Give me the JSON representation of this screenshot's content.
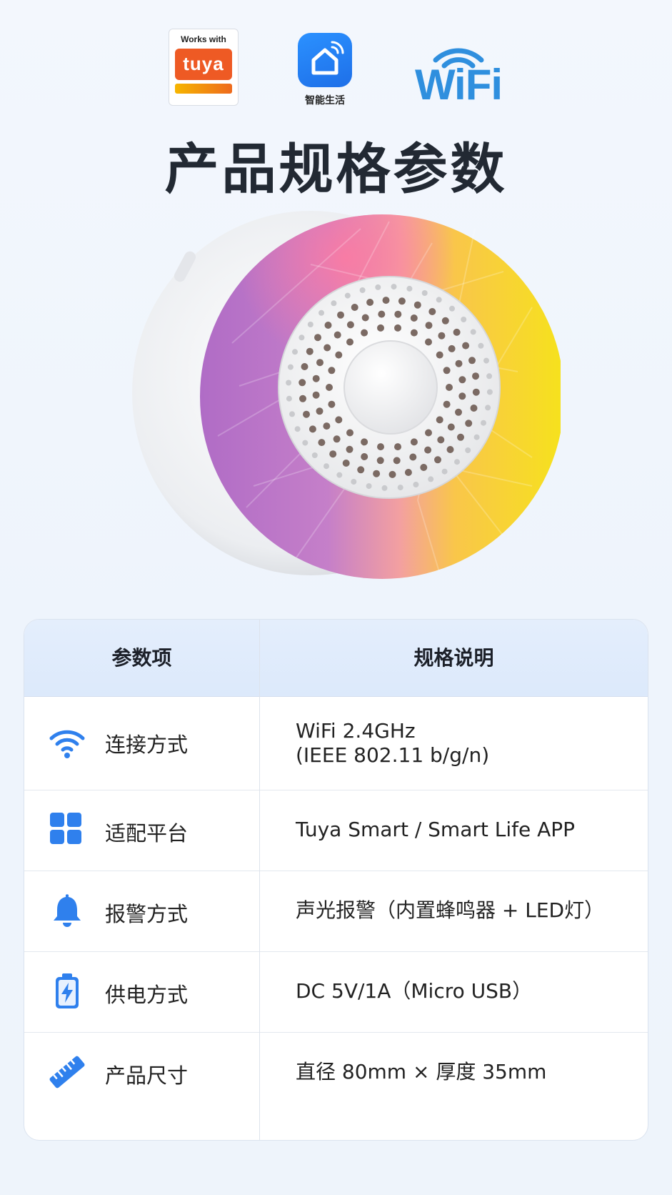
{
  "logos": {
    "tuya_works_with": "Works with",
    "tuya_word": "tuya",
    "app_caption": "智能生活",
    "wifi_word": "WiFi"
  },
  "title": "产品规格参数",
  "table": {
    "header": {
      "param": "参数项",
      "spec": "规格说明"
    },
    "rows": [
      {
        "icon": "wifi-icon",
        "label": "连接方式",
        "value_line1": "WiFi 2.4GHz",
        "value_line2": "(IEEE 802.11 b/g/n)"
      },
      {
        "icon": "grid-icon",
        "label": "适配平台",
        "value_line1": "Tuya Smart / Smart Life APP"
      },
      {
        "icon": "bell-icon",
        "label": "报警方式",
        "value_line1": "声光报警（内置蜂鸣器 + LED灯）"
      },
      {
        "icon": "battery-icon",
        "label": "供电方式",
        "value_line1": "DC 5V/1A（Micro USB）"
      },
      {
        "icon": "ruler-icon",
        "label": "产品尺寸",
        "value_line1": "直径 80mm × 厚度 35mm"
      }
    ]
  },
  "colors": {
    "accent": "#2f80ed",
    "tuya_orange": "#ee5a24",
    "header_bg": "#e2edfb"
  }
}
